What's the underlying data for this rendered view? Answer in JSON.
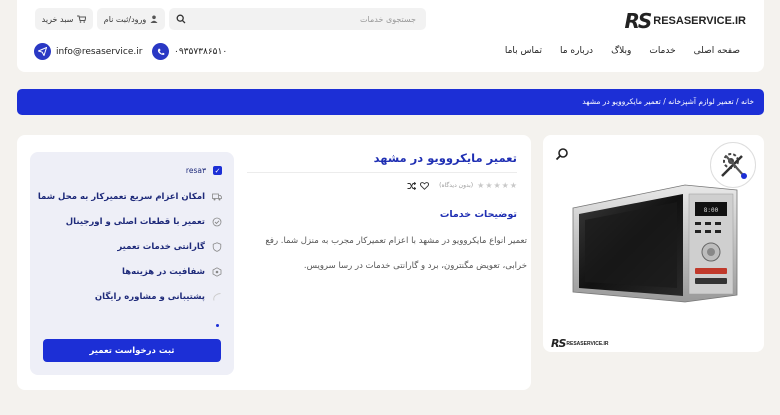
{
  "header": {
    "logo_text": "RESASERVICE.IR",
    "logo_mark": "RS",
    "search_placeholder": "جستجوی خدمات",
    "login_label": "ورود/ثبت نام",
    "cart_label": "سبد خرید",
    "nav": [
      {
        "label": "صفحه اصلی"
      },
      {
        "label": "خدمات"
      },
      {
        "label": "وبلاگ"
      },
      {
        "label": "درباره ما"
      },
      {
        "label": "تماس باما"
      }
    ],
    "phone": "۰۹۳۵۷۳۸۶۵۱۰",
    "email": "info@resaservice.ir"
  },
  "breadcrumb": {
    "items": [
      "خانه",
      "تعمیر لوازم آشپزخانه",
      "تعمیر مایکروویو در مشهد"
    ],
    "separator": " / "
  },
  "image_card": {
    "logo_mark": "RS",
    "logo_text": "RESASERVICE.IR"
  },
  "product": {
    "title": "تعمیر مایکروویو در مشهد",
    "rating_text": "(بدون دیدگاه)",
    "rating": 0,
    "rating_max": 5,
    "desc_title": "توضیحات خدمات",
    "description": "تعمیر انواع مایکروویو در مشهد با اعزام تعمیرکار مجرب به منزل شما. رفع خرابی، تعویض مگنترون، برد و گارانتی خدمات در رسا سرویس."
  },
  "features": {
    "head_label": "resa۳",
    "items": [
      {
        "label": "امکان اعزام سریع تعمیرکار به محل شما"
      },
      {
        "label": "تعمیر با قطعات اصلی و اورجینال"
      },
      {
        "label": "گارانتی خدمات تعمیر"
      },
      {
        "label": "شفافیت در هزینه‌ها"
      },
      {
        "label": "پشتیبانی و مشاوره رایگان"
      }
    ],
    "cta_label": "ثبت درخواست تعمیر"
  },
  "colors": {
    "primary": "#1c2fd6",
    "title_blue": "#1f2fb3",
    "background": "#f4f2ee"
  }
}
